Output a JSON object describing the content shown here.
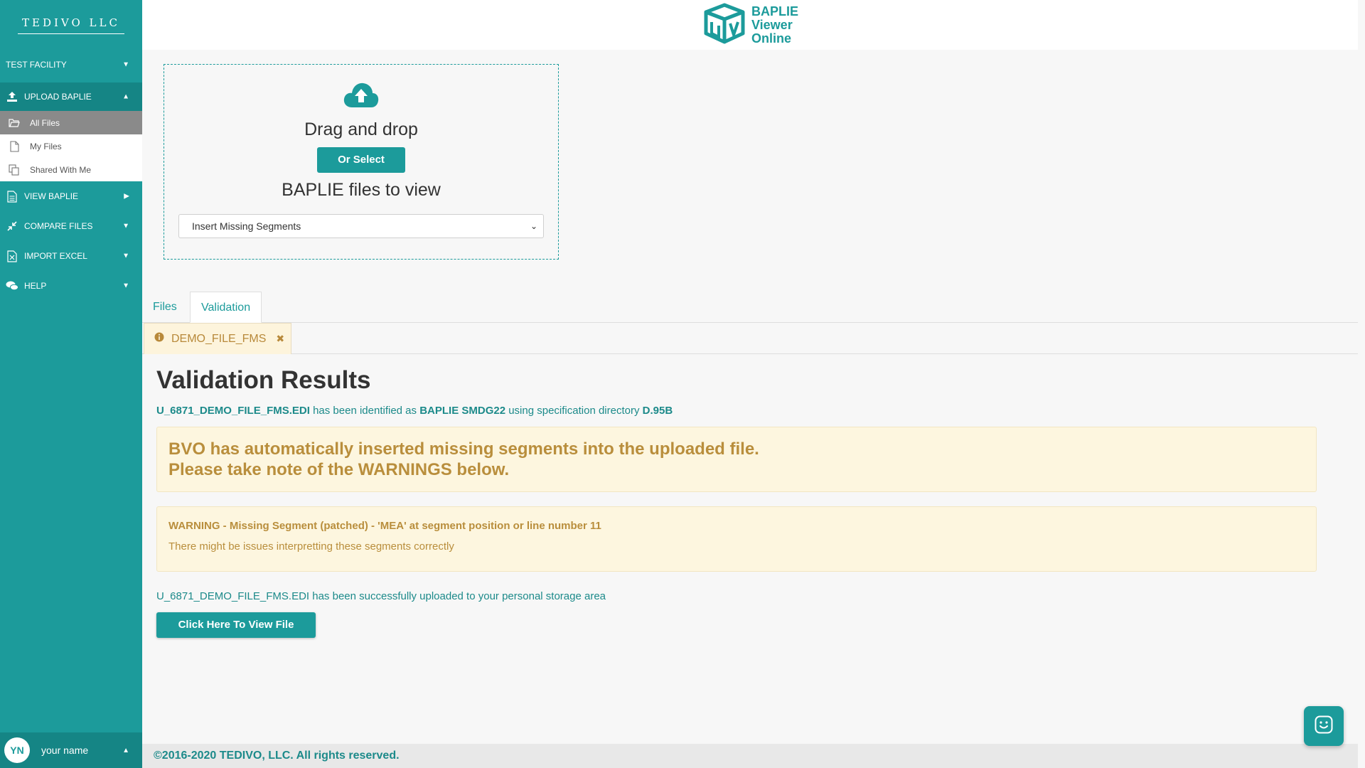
{
  "sidebar": {
    "brand": "TEDIVO LLC",
    "facility": "TEST FACILITY",
    "upload": "UPLOAD BAPLIE",
    "sub_items": [
      "All Files",
      "My Files",
      "Shared With Me"
    ],
    "view": "VIEW BAPLIE",
    "compare": "COMPARE FILES",
    "import": "IMPORT EXCEL",
    "help": "HELP",
    "user_initials": "YN",
    "user_name": "your name"
  },
  "header": {
    "logo_line1": "BAPLIE",
    "logo_line2": "Viewer",
    "logo_line3": "Online"
  },
  "upload": {
    "title": "Drag and drop",
    "select_button": "Or Select",
    "subtitle": "BAPLIE files to view",
    "dropdown_value": "Insert Missing Segments"
  },
  "tabs": [
    "Files",
    "Validation"
  ],
  "file_tab": "DEMO_FILE_FMS",
  "results": {
    "title": "Validation Results",
    "ident_file": "U_6871_DEMO_FILE_FMS.EDI",
    "ident_mid1": " has been identified as ",
    "ident_type": "BAPLIE SMDG22",
    "ident_mid2": " using specification directory ",
    "ident_dir": "D.95B",
    "alert_line1": "BVO has automatically inserted missing segments into the uploaded file.",
    "alert_line2": "Please take note of the WARNINGS below.",
    "warning_title": "WARNING - Missing Segment (patched) - 'MEA' at segment position or line number 11",
    "warning_text": "There might be issues interpretting these segments correctly",
    "uploaded_msg": "U_6871_DEMO_FILE_FMS.EDI has been successfully uploaded to your personal storage area",
    "view_button": "Click Here To View File"
  },
  "footer": {
    "copyright": "©2016-2020 TEDIVO, LLC. All rights reserved."
  },
  "colors": {
    "brand_teal": "#1c9b9b",
    "warning_text": "#b98e3c",
    "warning_bg": "#fdf6df"
  }
}
